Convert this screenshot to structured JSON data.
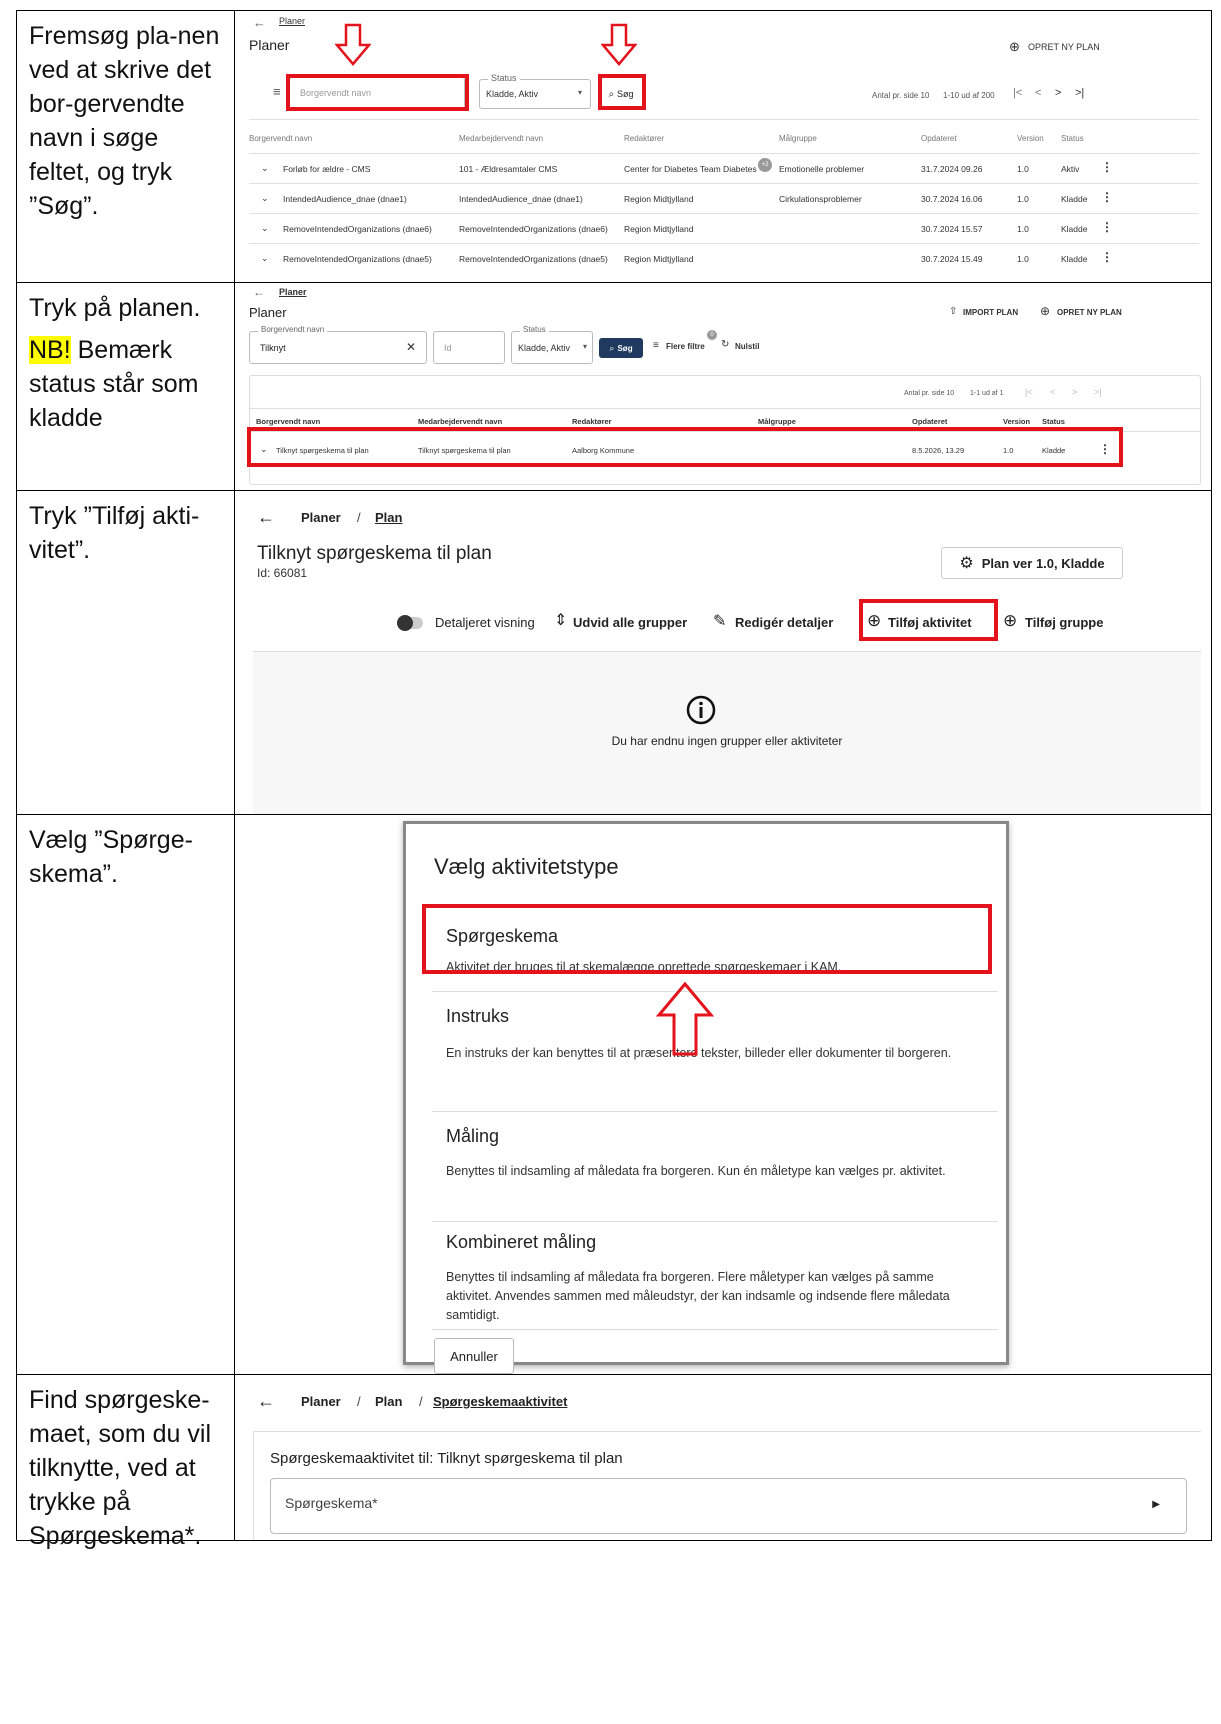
{
  "steps": [
    {
      "text": "Fremsøg pla-nen ved at skrive det bor-gervendte navn i søge feltet, og tryk ”Søg”."
    },
    {
      "text": "Tryk på planen.",
      "nb": "NB!",
      "nb_text": " Bemærk status står som kladde"
    },
    {
      "text": "Tryk ”Tilføj akti-vitet”."
    },
    {
      "text": "Vælg ”Spørge-skema”."
    },
    {
      "text": "Find spørgeske-maet, som du vil tilknytte, ved at trykke på Spørgeskema*."
    }
  ],
  "s1": {
    "breadcrumb": "Planer",
    "title": "Planer",
    "create_btn": "OPRET NY PLAN",
    "search_placeholder": "Borgervendt navn",
    "status_label": "Status",
    "status_value": "Kladde, Aktiv",
    "search_btn": "Søg",
    "per_page": "Antal pr. side 10",
    "range": "1-10 ud af 200",
    "headers": [
      "Borgervendt navn",
      "Medarbejdervendt navn",
      "Redaktører",
      "Målgruppe",
      "Opdateret",
      "Version",
      "Status"
    ],
    "rows": [
      [
        "Forløb for ældre - CMS",
        "101 - Ældresamtaler CMS",
        "Center for Diabetes Team Diabetes",
        "Emotionelle problemer",
        "31.7.2024 09.26",
        "1.0",
        "Aktiv"
      ],
      [
        "IntendedAudience_dnae (dnae1)",
        "IntendedAudience_dnae (dnae1)",
        "Region Midtjylland",
        "Cirkulationsproblemer",
        "30.7.2024 16.06",
        "1.0",
        "Kladde"
      ],
      [
        "RemoveIntendedOrganizations (dnae6)",
        "RemoveIntendedOrganizations (dnae6)",
        "Region Midtjylland",
        "",
        "30.7.2024 15.57",
        "1.0",
        "Kladde"
      ],
      [
        "RemoveIntendedOrganizations (dnae5)",
        "RemoveIntendedOrganizations (dnae5)",
        "Region Midtjylland",
        "",
        "30.7.2024 15.49",
        "1.0",
        "Kladde"
      ]
    ],
    "badge": "+2"
  },
  "s2": {
    "breadcrumb": "Planer",
    "title": "Planer",
    "import_btn": "IMPORT PLAN",
    "create_btn": "OPRET NY PLAN",
    "name_label": "Borgervendt navn",
    "name_value": "Tilknyt",
    "id_placeholder": "Id",
    "status_label": "Status",
    "status_value": "Kladde, Aktiv",
    "search_btn": "Søg",
    "more_filters": "Flere filtre",
    "filter_count": "0",
    "reset": "Nulstil",
    "per_page": "Antal pr. side 10",
    "range": "1-1 ud af 1",
    "headers": [
      "Borgervendt navn",
      "Medarbejdervendt navn",
      "Redaktører",
      "Målgruppe",
      "Opdateret",
      "Version",
      "Status"
    ],
    "row": [
      "Tilknyt spørgeskema til plan",
      "Tilknyt spørgeskema til plan",
      "Aalborg Kommune",
      "",
      "8.5.2026, 13.29",
      "1.0",
      "Kladde"
    ]
  },
  "s3": {
    "bc_planer": "Planer",
    "bc_sep": "/",
    "bc_plan": "Plan",
    "title": "Tilknyt spørgeskema til plan",
    "id": "Id: 66081",
    "version_btn": "Plan ver 1.0, Kladde",
    "detailed": "Detaljeret visning",
    "expand": "Udvid alle grupper",
    "edit": "Redigér detaljer",
    "add_activity": "Tilføj aktivitet",
    "add_group": "Tilføj gruppe",
    "empty": "Du har endnu ingen grupper eller aktiviteter"
  },
  "s4": {
    "title": "Vælg aktivitetstype",
    "options": [
      {
        "name": "Spørgeskema",
        "desc": "Aktivitet der bruges til at skemalægge oprettede spørgeskemaer i KAM."
      },
      {
        "name": "Instruks",
        "desc": "En instruks der kan benyttes til at præsentere tekster, billeder eller dokumenter til borgeren."
      },
      {
        "name": "Måling",
        "desc": "Benyttes til indsamling af måledata fra borgeren. Kun én måletype kan vælges pr. aktivitet."
      },
      {
        "name": "Kombineret måling",
        "desc": "Benyttes til indsamling af måledata fra borgeren. Flere måletyper kan vælges på samme aktivitet. Anvendes sammen med måleudstyr, der kan indsamle og indsende flere måledata samtidigt."
      }
    ],
    "cancel": "Annuller"
  },
  "s5": {
    "bc_planer": "Planer",
    "bc_sep": "/",
    "bc_plan": "Plan",
    "bc_sep2": "/",
    "bc_current": "Spørgeskemaaktivitet",
    "title": "Spørgeskemaaktivitet til: Tilknyt spørgeskema til plan",
    "field": "Spørgeskema*"
  },
  "colors": {
    "red": "#e3121b",
    "navy": "#1f3a5f",
    "highlight": "#ffff00"
  }
}
